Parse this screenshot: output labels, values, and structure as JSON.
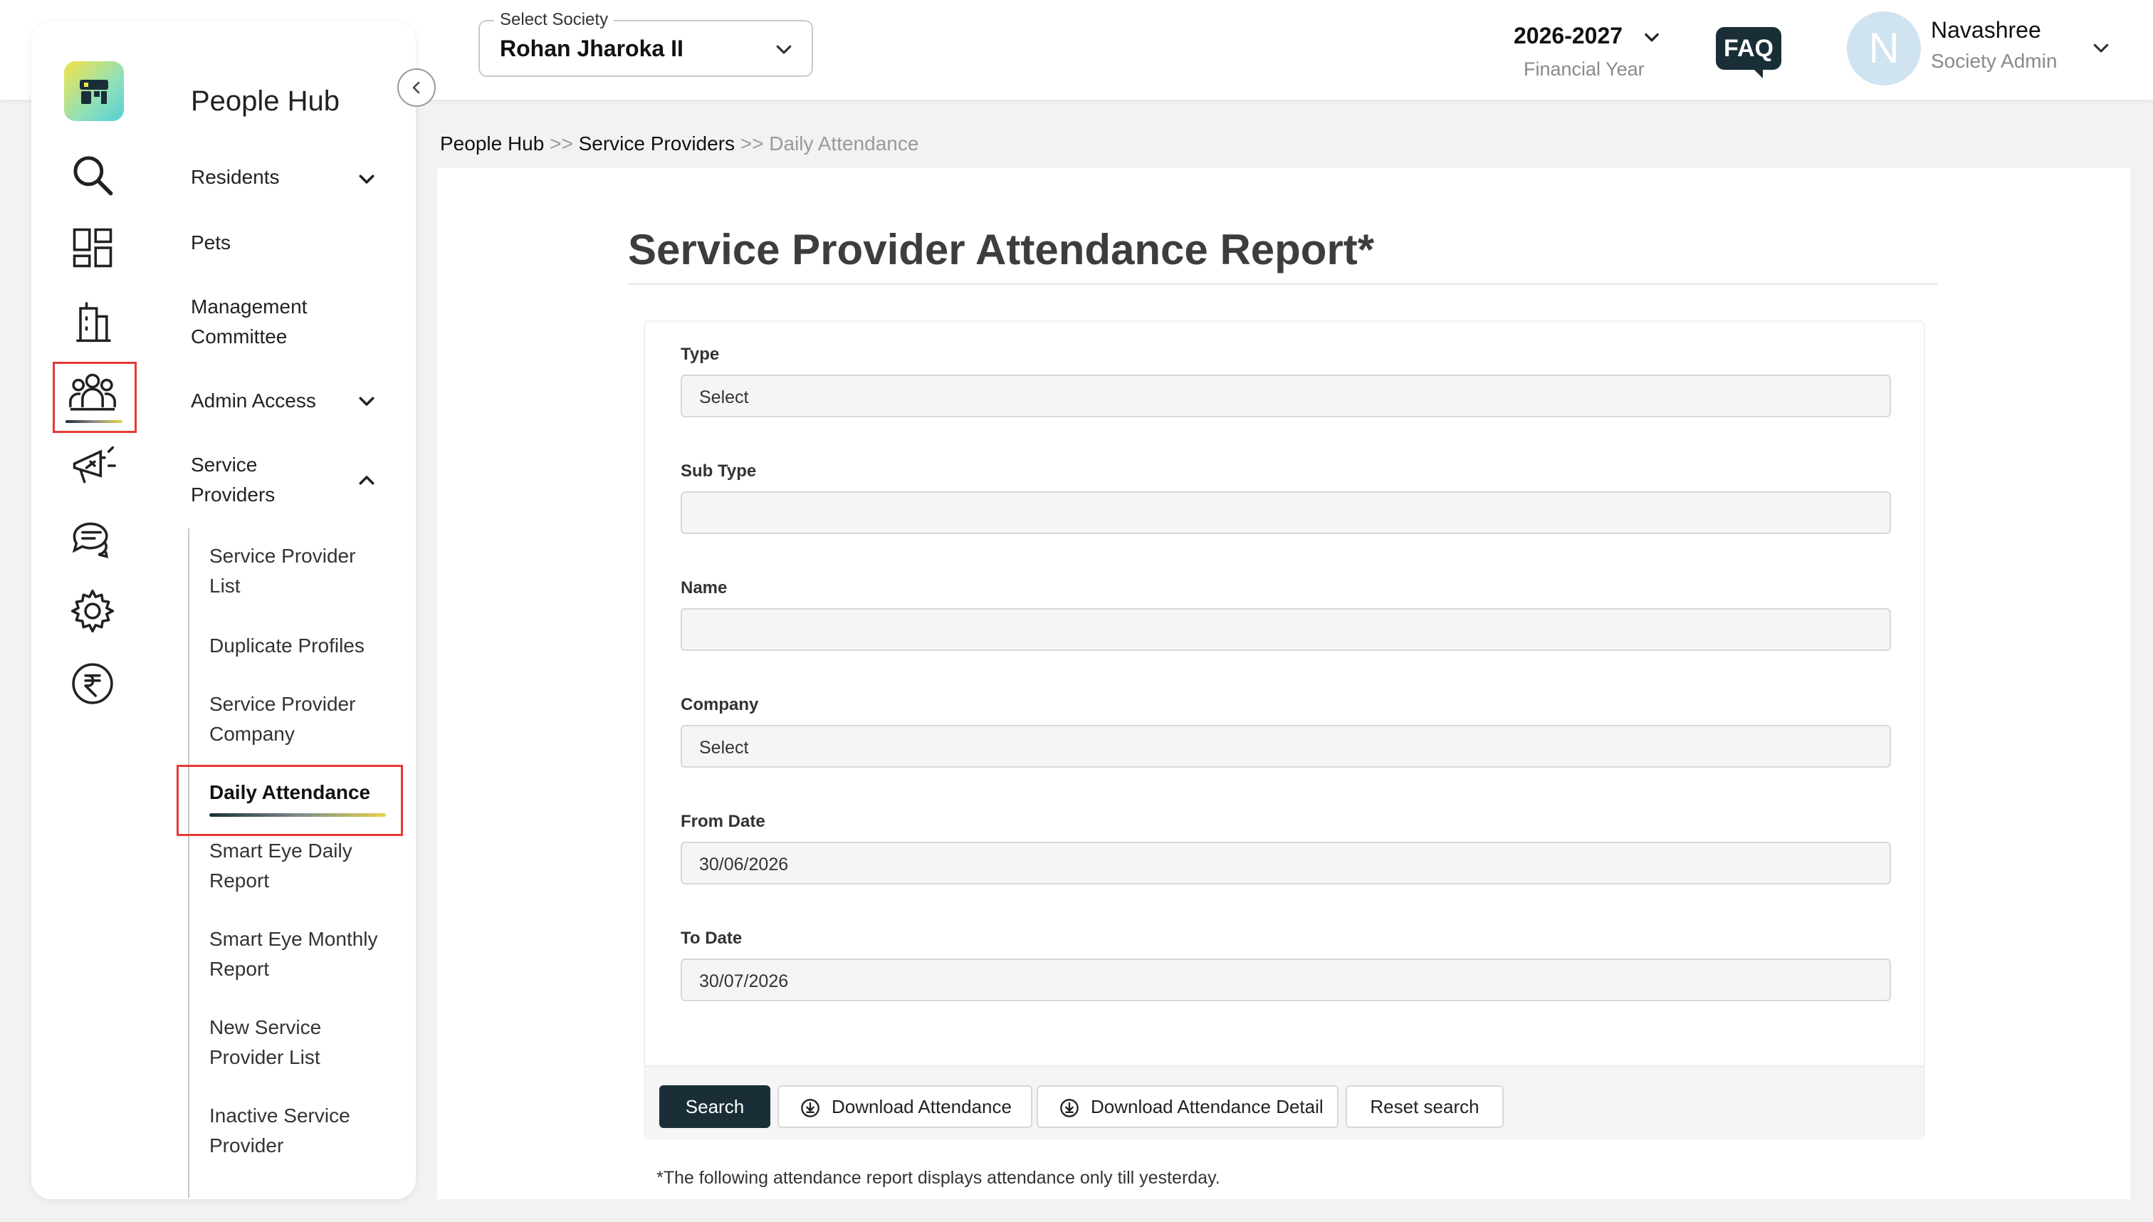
{
  "header": {
    "society_label": "Select Society",
    "society_value": "Rohan Jharoka II",
    "financial_year": "2026-2027",
    "financial_year_label": "Financial Year",
    "faq": "FAQ",
    "avatar_initial": "N",
    "user_name": "Navashree",
    "user_role": "Society Admin"
  },
  "sidebar": {
    "title": "People Hub",
    "rail_icons": [
      "search-icon",
      "dashboard-icon",
      "building-icon",
      "people-icon",
      "megaphone-icon",
      "chat-icon",
      "gear-icon",
      "rupee-icon"
    ],
    "menu": {
      "residents": "Residents",
      "pets": "Pets",
      "management_committee_1": "Management",
      "management_committee_2": "Committee",
      "admin_access": "Admin Access",
      "service_providers_1": "Service",
      "service_providers_2": "Providers"
    },
    "submenu": {
      "sp_list_1": "Service Provider",
      "sp_list_2": "List",
      "duplicate_profiles": "Duplicate Profiles",
      "sp_company_1": "Service Provider",
      "sp_company_2": "Company",
      "daily_attendance": "Daily Attendance",
      "smart_eye_daily_1": "Smart Eye Daily",
      "smart_eye_daily_2": "Report",
      "smart_eye_monthly_1": "Smart Eye Monthly",
      "smart_eye_monthly_2": "Report",
      "new_sp_list_1": "New Service",
      "new_sp_list_2": "Provider List",
      "inactive_sp_1": "Inactive Service",
      "inactive_sp_2": "Provider"
    }
  },
  "breadcrumb": {
    "item1": "People Hub",
    "sep": ">>",
    "item2": "Service Providers",
    "item3": "Daily Attendance"
  },
  "main": {
    "title": "Service Provider Attendance Report*",
    "fields": {
      "type_label": "Type",
      "type_value": "Select",
      "subtype_label": "Sub Type",
      "subtype_value": "",
      "name_label": "Name",
      "name_value": "",
      "company_label": "Company",
      "company_value": "Select",
      "from_label": "From Date",
      "from_value": "30/06/2026",
      "to_label": "To Date",
      "to_value": "30/07/2026"
    },
    "buttons": {
      "search": "Search",
      "download_attendance": "Download Attendance",
      "download_detail": "Download Attendance Detail",
      "reset": "Reset search"
    },
    "footnote": "*The following attendance report displays attendance only till yesterday."
  }
}
